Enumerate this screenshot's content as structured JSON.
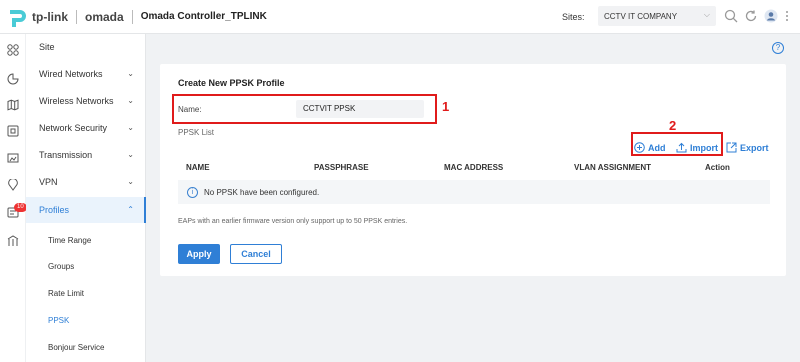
{
  "header": {
    "brand": "tp-link",
    "product": "omada",
    "controller_name": "Omada Controller_TPLINK",
    "sites_label": "Sites:",
    "site_selected": "CCTV IT COMPANY"
  },
  "sidebar": {
    "badge_count": "10",
    "items": [
      {
        "label": "Site"
      },
      {
        "label": "Wired Networks"
      },
      {
        "label": "Wireless Networks"
      },
      {
        "label": "Network Security"
      },
      {
        "label": "Transmission"
      },
      {
        "label": "VPN"
      },
      {
        "label": "Profiles"
      }
    ],
    "sub_items": [
      {
        "label": "Time Range"
      },
      {
        "label": "Groups"
      },
      {
        "label": "Rate Limit"
      },
      {
        "label": "PPSK"
      },
      {
        "label": "Bonjour Service"
      }
    ]
  },
  "form": {
    "title": "Create New PPSK Profile",
    "name_label": "Name:",
    "name_value": "CCTVIT PPSK",
    "list_label": "PPSK List",
    "add_label": "Add",
    "import_label": "Import",
    "export_label": "Export",
    "columns": [
      "NAME",
      "PASSPHRASE",
      "MAC ADDRESS",
      "VLAN ASSIGNMENT",
      "Action"
    ],
    "empty_message": "No PPSK have been configured.",
    "note": "EAPs with an earlier firmware version only support up to 50 PPSK entries.",
    "apply_label": "Apply",
    "cancel_label": "Cancel"
  },
  "annotations": {
    "marker_1": "1",
    "marker_2": "2",
    "color": "#e01b1b"
  },
  "colors": {
    "accent": "#2f7fd6",
    "brand_logo": "#4acbd6"
  }
}
